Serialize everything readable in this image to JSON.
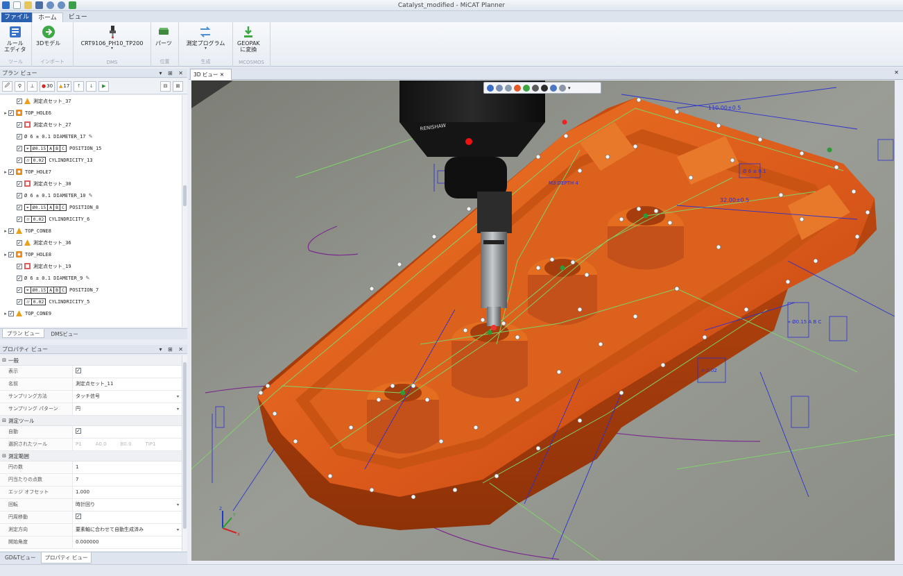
{
  "window": {
    "title": "Catalyst_modified - MiCAT Planner"
  },
  "ribbon": {
    "file_tab": "ファイル",
    "tabs": [
      "ホーム",
      "ビュー"
    ],
    "groups": [
      {
        "label": "ツール",
        "buttons": [
          {
            "label": "ルール\nエディタ",
            "icon": "rule-editor-icon"
          }
        ]
      },
      {
        "label": "インポート",
        "buttons": [
          {
            "label": "3Dモデル",
            "icon": "import-3d-icon"
          }
        ]
      },
      {
        "label": "DMS",
        "buttons": [
          {
            "label": "CRT9106_PH10_TP200",
            "icon": "probe-head-icon"
          }
        ]
      },
      {
        "label": "位置",
        "buttons": [
          {
            "label": "パーツ",
            "icon": "part-icon"
          }
        ]
      },
      {
        "label": "生成",
        "buttons": [
          {
            "label": "測定プログラム",
            "icon": "generate-program-icon"
          }
        ]
      },
      {
        "label": "MCOSMOS",
        "buttons": [
          {
            "label": "GEOPAK\nに変換",
            "icon": "export-geopak-icon"
          }
        ]
      }
    ]
  },
  "plan_view": {
    "title": "プラン ビュー",
    "toolbar": {
      "error_count": "30",
      "warn_count": "17"
    },
    "tree": [
      {
        "indent": 2,
        "expander": "",
        "icon": "point-set-warning",
        "label": "測定点セット_37"
      },
      {
        "indent": 1,
        "expander": "▸",
        "icon": "hole-feature",
        "label": "TOP_HOLE6"
      },
      {
        "indent": 2,
        "expander": "",
        "icon": "point-set-error",
        "label": "測定点セット_27"
      },
      {
        "indent": 2,
        "expander": "",
        "icon": "diameter",
        "label": "Ø 6 ± 0.1 DIAMETER_17"
      },
      {
        "indent": 2,
        "expander": "",
        "icon": "position-fcf",
        "fcf": [
          "⌖",
          "Ø0.15",
          "A",
          "B",
          "C"
        ],
        "label": "POSITION_15"
      },
      {
        "indent": 2,
        "expander": "",
        "icon": "cylindricity-fcf",
        "fcf": [
          "⌭",
          "0.02"
        ],
        "label": "CYLINDRICITY_13"
      },
      {
        "indent": 1,
        "expander": "▸",
        "icon": "hole-feature",
        "label": "TOP_HOLE7"
      },
      {
        "indent": 2,
        "expander": "",
        "icon": "point-set-error",
        "label": "測定点セット_30"
      },
      {
        "indent": 2,
        "expander": "",
        "icon": "diameter",
        "label": "Ø 6 ± 0.1 DIAMETER_10"
      },
      {
        "indent": 2,
        "expander": "",
        "icon": "position-fcf",
        "fcf": [
          "⌖",
          "Ø0.15",
          "A",
          "B",
          "C"
        ],
        "label": "POSITION_8"
      },
      {
        "indent": 2,
        "expander": "",
        "icon": "cylindricity-fcf",
        "fcf": [
          "⌭",
          "0.02"
        ],
        "label": "CYLINDRICITY_6"
      },
      {
        "indent": 1,
        "expander": "▸",
        "icon": "cone-warning",
        "label": "TOP_CONE8"
      },
      {
        "indent": 2,
        "expander": "",
        "icon": "point-set-warning",
        "label": "測定点セット_36"
      },
      {
        "indent": 1,
        "expander": "▸",
        "icon": "hole-feature",
        "label": "TOP_HOLE8"
      },
      {
        "indent": 2,
        "expander": "",
        "icon": "point-set-error",
        "label": "測定点セット_19"
      },
      {
        "indent": 2,
        "expander": "",
        "icon": "diameter",
        "label": "Ø 6 ± 0.1 DIAMETER_9"
      },
      {
        "indent": 2,
        "expander": "",
        "icon": "position-fcf",
        "fcf": [
          "⌖",
          "Ø0.15",
          "A",
          "B",
          "C"
        ],
        "label": "POSITION_7"
      },
      {
        "indent": 2,
        "expander": "",
        "icon": "cylindricity-fcf",
        "fcf": [
          "⌭",
          "0.02"
        ],
        "label": "CYLINDRICITY_5"
      },
      {
        "indent": 1,
        "expander": "▸",
        "icon": "cone-warning",
        "label": "TOP_CONE9"
      }
    ],
    "tabs": [
      "プラン ビュー",
      "DMSビュー"
    ]
  },
  "property_view": {
    "title": "プロパティ ビュー",
    "categories": [
      {
        "name": "一般",
        "rows": [
          {
            "key": "表示",
            "type": "check",
            "value": ""
          },
          {
            "key": "名前",
            "type": "text",
            "value": "測定点セット_11"
          },
          {
            "key": "サンプリング方法",
            "type": "select",
            "value": "タッチ信号"
          },
          {
            "key": "サンプリング パターン",
            "type": "select",
            "value": "円"
          }
        ]
      },
      {
        "name": "測定ツール",
        "rows": [
          {
            "key": "自動",
            "type": "check",
            "value": ""
          },
          {
            "key": "選択されたツール",
            "type": "tools",
            "value": "",
            "tools": [
              "P1",
              "A0.0",
              "B0.0",
              "TIP1"
            ]
          }
        ]
      },
      {
        "name": "測定範囲",
        "rows": [
          {
            "key": "円の数",
            "type": "text",
            "value": "1"
          },
          {
            "key": "円当たりの点数",
            "type": "text",
            "value": "7"
          },
          {
            "key": "エッジ オフセット",
            "type": "text",
            "value": "1.000"
          },
          {
            "key": "回転",
            "type": "select",
            "value": "時計回り"
          },
          {
            "key": "円周移動",
            "type": "check",
            "value": ""
          },
          {
            "key": "測定方向",
            "type": "select",
            "value": "要素軸に合わせて自動生成済み"
          },
          {
            "key": "開始角度",
            "type": "text",
            "value": "0.000000"
          }
        ]
      }
    ],
    "bottom_tabs": [
      "GD&Tビュー",
      "プロパティ ビュー"
    ]
  },
  "view3d": {
    "tab_label": "3D ビュー",
    "annotations": [
      "110.00±0.5",
      "32.00±0.5",
      "Ø 6 ± 0.1",
      "M3 DEPTH 4",
      "⌖ Ø0.15 A B C",
      "⌭ 0.02"
    ],
    "colors": {
      "part": "#e1631a",
      "background": "#8c8f86",
      "path": "#7fd36b",
      "dimension": "#2b2fd0",
      "arc": "#7b2a8f"
    }
  }
}
